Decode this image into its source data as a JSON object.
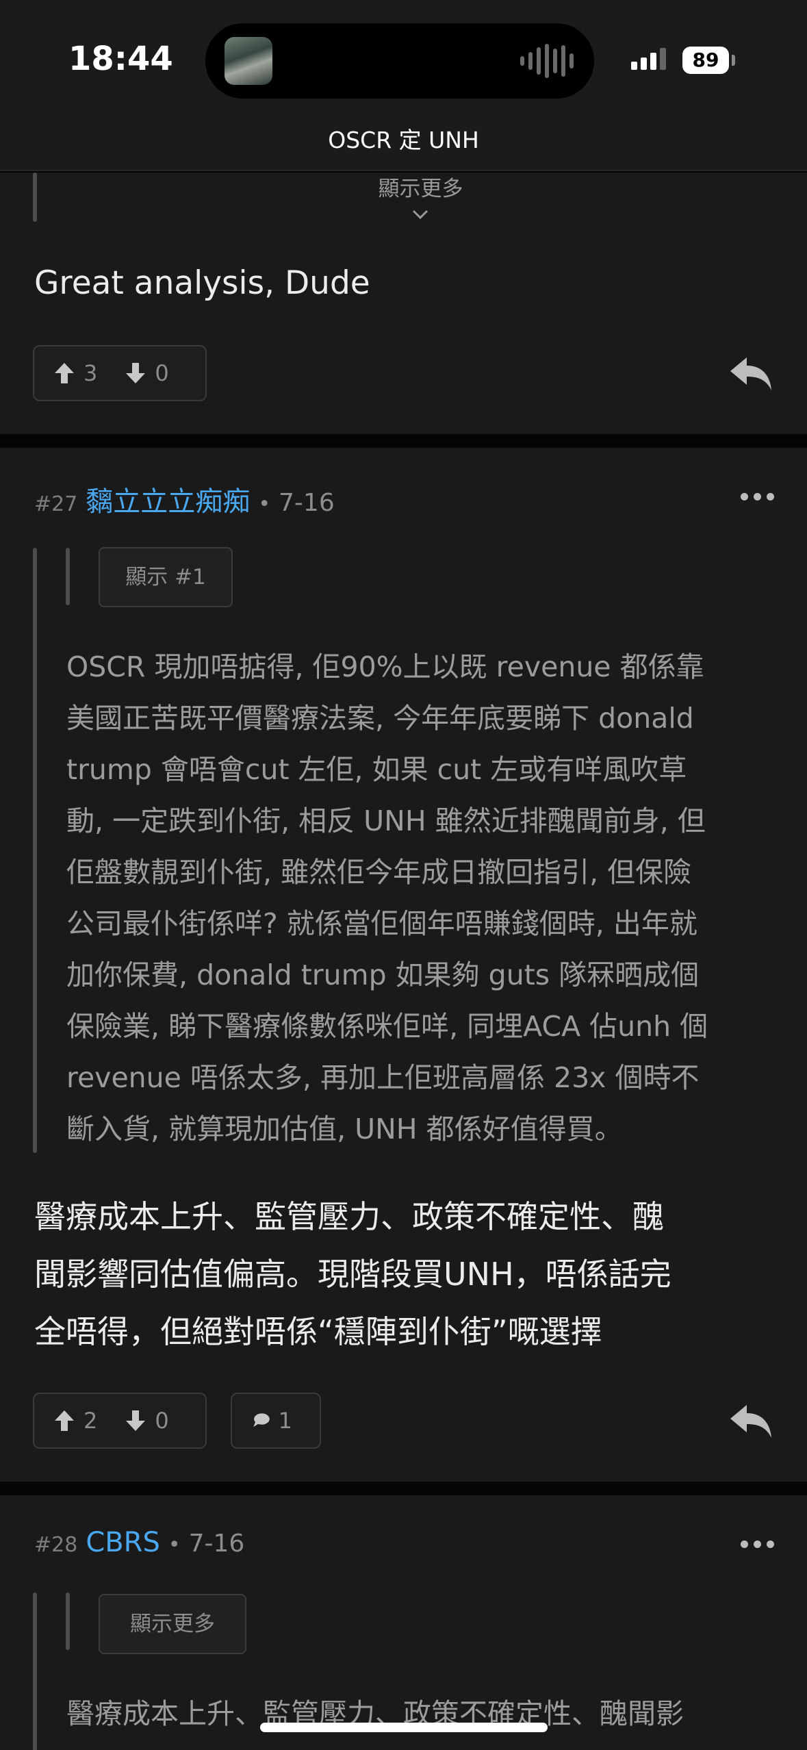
{
  "status_bar": {
    "time": "18:44",
    "battery": "89"
  },
  "header": {
    "title": "OSCR 定 UNH"
  },
  "post_prev": {
    "show_more": "顯示更多",
    "text": "Great analysis, Dude",
    "upvotes": "3",
    "downvotes": "0"
  },
  "post_27": {
    "floor": "#27",
    "user": "黐立立立痴痴",
    "date": "7-16",
    "quote_ref": "顯示 #1",
    "quote_lines": [
      "OSCR 現加唔掂得, 佢90%上以既 revenue 都係靠",
      "美國正苦既平價醫療法案, 今年年底要睇下 donald",
      "trump 會唔會cut 左佢, 如果 cut 左或有咩風吹草",
      "動, 一定跌到仆街, 相反 UNH 雖然近排醜聞前身, 但",
      "佢盤數靚到仆街, 雖然佢今年成日撤回指引, 但保險",
      "公司最仆街係咩? 就係當佢個年唔賺錢個時, 出年就",
      "加你保費, donald trump 如果夠 guts 隊冧晒成個",
      "保險業, 睇下醫療條數係咪佢咩, 同埋ACA 佔unh 個",
      "revenue 唔係太多, 再加上佢班高層係 23x 個時不",
      "斷入貨, 就算現加估值, UNH 都係好值得買。"
    ],
    "text_lines": [
      "醫療成本上升、監管壓力、政策不確定性、醜",
      "聞影響同估值偏高。現階段買UNH，唔係話完",
      "全唔得，但絕對唔係“穩陣到仆街”嘅選擇"
    ],
    "upvotes": "2",
    "downvotes": "0",
    "comments": "1"
  },
  "post_28": {
    "floor": "#28",
    "user": "CBRS",
    "date": "7-16",
    "quote_ref": "顯示更多",
    "quote_first_line": "醫療成本上升、監管壓力、政策不確定性、醜聞影"
  },
  "colors": {
    "accent": "#4aa8f0",
    "card": "#1a1a1a",
    "divider": "#050505"
  }
}
